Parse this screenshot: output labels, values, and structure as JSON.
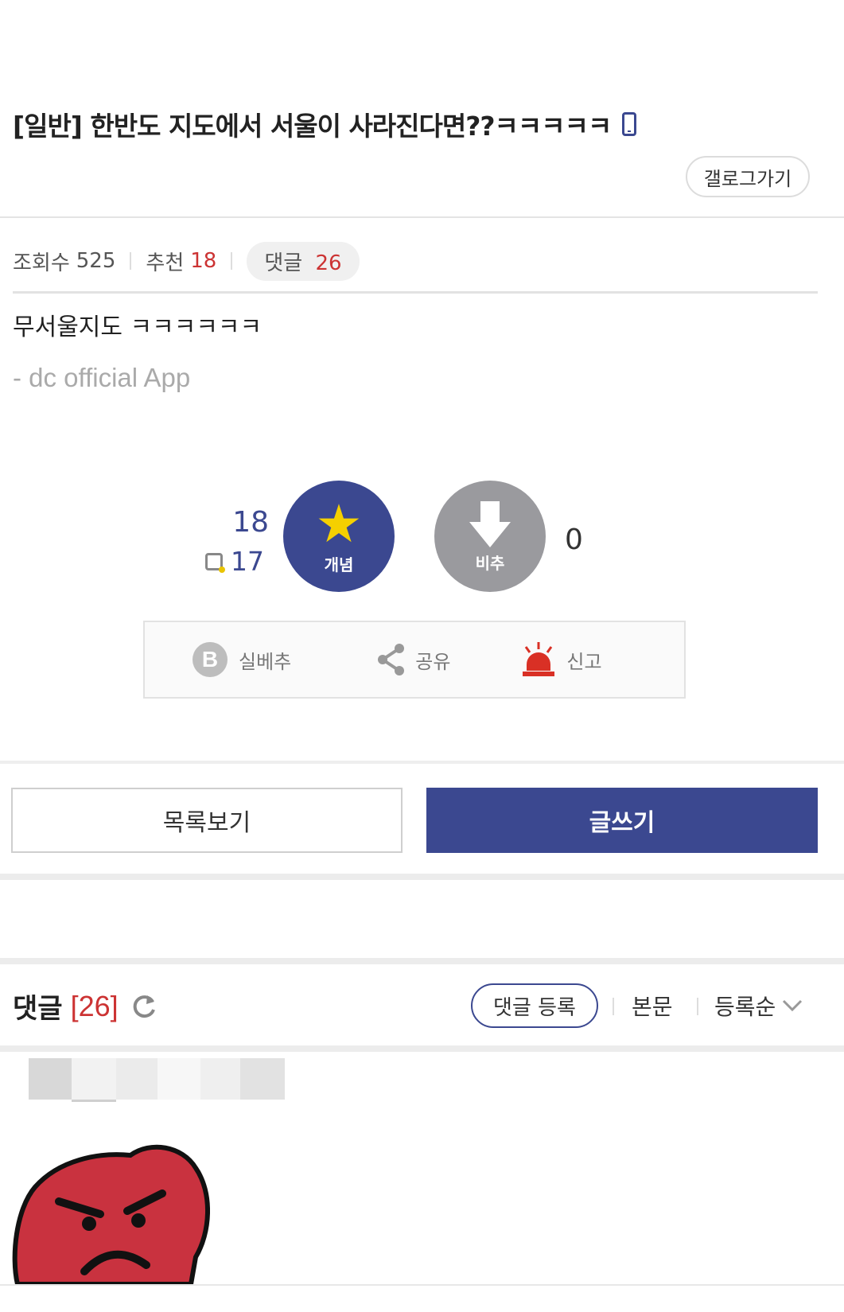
{
  "post": {
    "title": "[일반] 한반도 지도에서 서울이 사라진다면??ㅋㅋㅋㅋㅋ",
    "gallery_button": "갤로그가기",
    "views_label": "조회수",
    "views": "525",
    "recommend_label": "추천",
    "recommend": "18",
    "comments_label": "댓글",
    "comments": "26",
    "body": "무서울지도 ㅋㅋㅋㅋㅋㅋ",
    "signature": "- dc official App"
  },
  "vote": {
    "up_count": "18",
    "mobile_up_count": "17",
    "up_label": "개념",
    "down_label": "비추",
    "down_count": "0"
  },
  "actions": {
    "best": "실베추",
    "best_icon_letter": "B",
    "share": "공유",
    "report": "신고"
  },
  "buttons": {
    "list": "목록보기",
    "write": "글쓰기"
  },
  "comments_header": {
    "title": "댓글",
    "count": "[26]",
    "register": "댓글 등록",
    "to_body": "본문",
    "sort": "등록순"
  },
  "colors": {
    "accent": "#3b4890",
    "red": "#cc3333",
    "gold": "#f5d000"
  }
}
